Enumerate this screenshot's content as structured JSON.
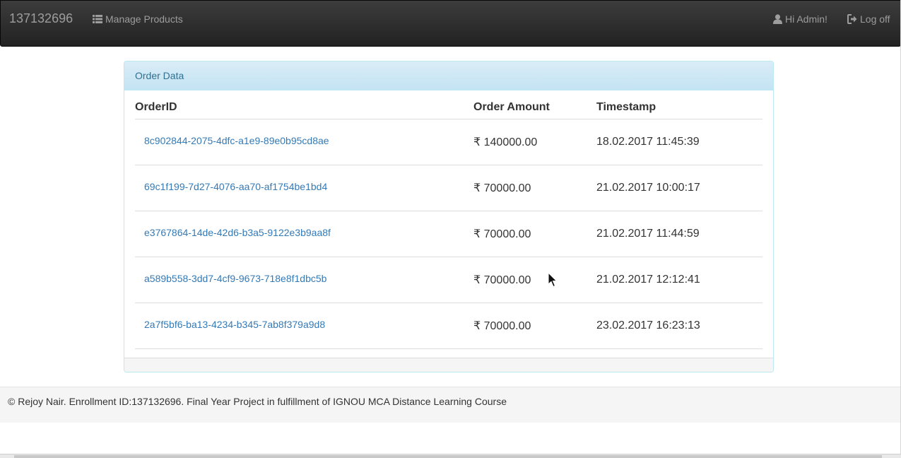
{
  "navbar": {
    "brand": "137132696",
    "manage_products": "Manage Products",
    "greeting": "Hi Admin!",
    "log_off": "Log off",
    "icons": {
      "manage": "list-icon",
      "user": "user-icon",
      "logoff": "log-out-icon"
    }
  },
  "panel": {
    "heading": "Order Data",
    "columns": [
      "OrderID",
      "Order Amount",
      "Timestamp"
    ],
    "rows": [
      {
        "order_id": "8c902844-2075-4dfc-a1e9-89e0b95cd8ae",
        "amount": "₹ 140000.00",
        "timestamp": "18.02.2017 11:45:39"
      },
      {
        "order_id": "69c1f199-7d27-4076-aa70-af1754be1bd4",
        "amount": "₹ 70000.00",
        "timestamp": "21.02.2017 10:00:17"
      },
      {
        "order_id": "e3767864-14de-42d6-b3a5-9122e3b9aa8f",
        "amount": "₹ 70000.00",
        "timestamp": "21.02.2017 11:44:59"
      },
      {
        "order_id": "a589b558-3dd7-4cf9-9673-718e8f1dbc5b",
        "amount": "₹ 70000.00",
        "timestamp": "21.02.2017 12:12:41"
      },
      {
        "order_id": "2a7f5bf6-ba13-4234-b345-7ab8f379a9d8",
        "amount": "₹ 70000.00",
        "timestamp": "23.02.2017 16:23:13"
      }
    ]
  },
  "footer": {
    "text": "© Rejoy Nair. Enrollment ID:137132696. Final Year Project in fulfillment of IGNOU MCA Distance Learning Course"
  },
  "colors": {
    "navbar_bg": "#222222",
    "nav_text": "#9d9d9d",
    "panel_heading_bg": "#d9edf7",
    "panel_heading_text": "#31708f",
    "link": "#337ab7"
  }
}
